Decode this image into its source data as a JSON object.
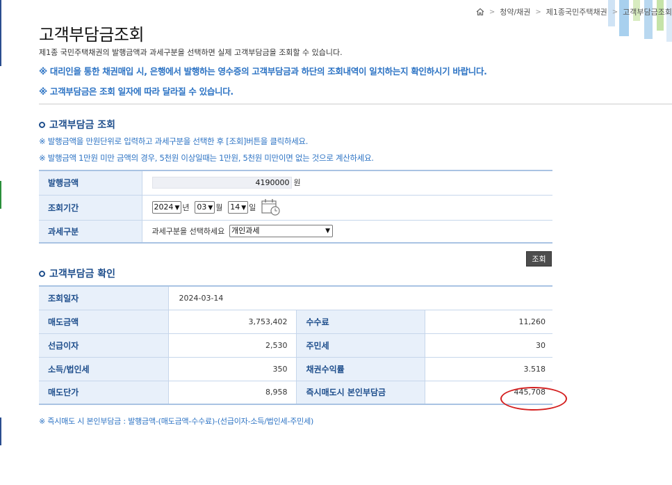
{
  "breadcrumb": {
    "items": [
      "청약/채권",
      "제1종국민주택채권",
      "고객부담금조회"
    ]
  },
  "header": {
    "title": "고객부담금조회",
    "description": "제1종 국민주택채권의 발행금액과 과세구분을 선택하면 실제 고객부담금을 조회할 수 있습니다.",
    "notice1": "※ 대리인을 통한 채권매입 시, 은행에서 발행하는 영수증의 고객부담금과 하단의 조회내역이 일치하는지 확인하시기 바랍니다.",
    "notice2": "※ 고객부담금은 조회 일자에 따라 달라질 수 있습니다."
  },
  "query_section": {
    "title": "고객부담금 조회",
    "guide1": "※ 발행금액을 만원단위로 입력하고 과세구분을 선택한 후 [조회]버튼을 클릭하세요.",
    "guide2": "※ 발행금액 1만원 미만 금액의 경우, 5천원 이상일때는 1만원, 5천원 미만이면 없는 것으로 계산하세요.",
    "amount_label": "발행금액",
    "amount_value": "4190000",
    "amount_unit": "원",
    "period_label": "조회기간",
    "year": "2024",
    "year_unit": "년",
    "month": "03",
    "month_unit": "월",
    "day": "14",
    "day_unit": "일",
    "tax_label": "과세구분",
    "tax_prompt": "과세구분을 선택하세요",
    "tax_selected": "개인과세",
    "query_button": "조회"
  },
  "result_section": {
    "title": "고객부담금 확인",
    "date_label": "조회일자",
    "date_value": "2024-03-14",
    "rows": [
      {
        "label1": "매도금액",
        "value1": "3,753,402",
        "label2": "수수료",
        "value2": "11,260"
      },
      {
        "label1": "선급이자",
        "value1": "2,530",
        "label2": "주민세",
        "value2": "30"
      },
      {
        "label1": "소득/법인세",
        "value1": "350",
        "label2": "채권수익률",
        "value2": "3.518"
      },
      {
        "label1": "매도단가",
        "value1": "8,958",
        "label2": "즉시매도시 본인부담금",
        "value2": "445,708"
      }
    ],
    "formula": "※ 즉시매도 시 본인부담금 : 발행금액-(매도금액-수수료)-(선급이자-소득/법인세-주민세)"
  },
  "colors": {
    "accent_blue": "#2c73c4",
    "title_blue": "#1e4e8c",
    "header_bg": "#e8f0fa",
    "highlight_red": "#d42020"
  }
}
